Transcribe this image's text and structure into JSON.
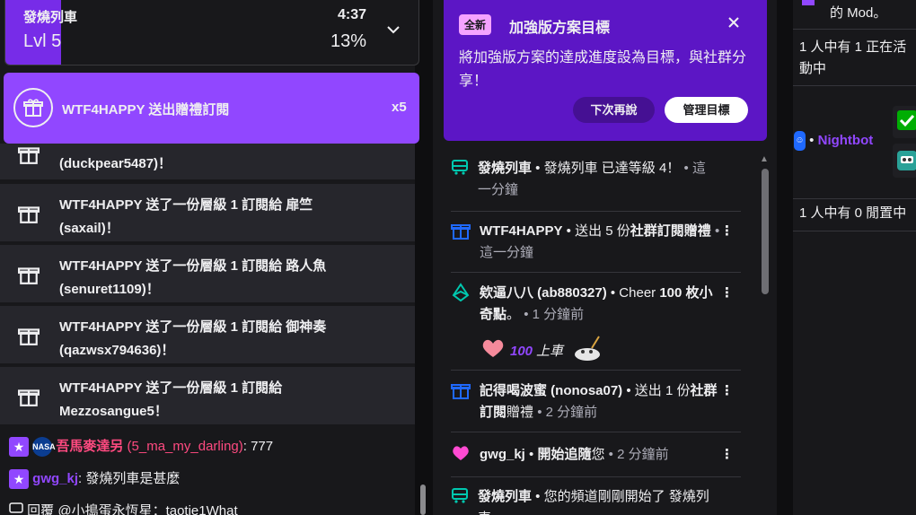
{
  "hype_train": {
    "name": "發燒列車",
    "level": "Lvl 5",
    "time": "4:37",
    "percent": "13%",
    "progress": 0.13
  },
  "ghost_text": "… … … … 的 的 … … …",
  "gift_banner": {
    "text": "WTF4HAPPY 送出贈禮訂閱",
    "count": "x5"
  },
  "gift_notices": [
    {
      "pre": "",
      "target": "",
      "line2": "(duckpear5487)！"
    },
    {
      "pre": "WTF4HAPPY 送了一份層級 1 訂閱給 ",
      "target": "扉竺",
      "line2": "(saxail)！"
    },
    {
      "pre": "WTF4HAPPY 送了一份層級 1 訂閱給 ",
      "target": "路人魚",
      "line2": "(senuret1109)！"
    },
    {
      "pre": "WTF4HAPPY 送了一份層級 1 訂閱給 ",
      "target": "御神奏",
      "line2": "(qazwsx794636)！"
    },
    {
      "pre": "WTF4HAPPY 送了一份層級 1 訂閱給",
      "target": "",
      "line2": "Mezzosangue5！"
    }
  ],
  "chat": [
    {
      "user": "吾馬麥達另",
      "login": " (5_ma_my_darling)",
      "msg": ": 777",
      "color": "#ff4a80"
    },
    {
      "user": "gwg_kj",
      "login": "",
      "msg": ": 發燒列車是甚麼",
      "color": "#9147ff"
    }
  ],
  "reply_line": "回覆 @小搗蛋永恆星：taotie1What",
  "goal": {
    "badge": "全新",
    "title": "加強版方案目標",
    "desc": "將加強版方案的達成進度設為目標，與社群分享！",
    "later": "下次再說",
    "manage": "管理目標"
  },
  "activity": [
    {
      "icon": "train",
      "name": "發燒列車",
      "text": " • 發燒列車 已達等級 4！",
      "time": " • 這一分鐘"
    },
    {
      "icon": "gift",
      "name": "WTF4HAPPY",
      "text": " • 送出 5 份",
      "bold": "社群訂閱",
      "text2": "贈禮",
      "time": " • 這一分鐘"
    },
    {
      "icon": "bits",
      "name": "欸逼八八 (ab880327)",
      "text": " • Cheer ",
      "bold": "100 枚小奇點",
      "text2": "。",
      "time": " • 1 分鐘前",
      "cheer_amount": "100",
      "cheer_msg": "上車"
    },
    {
      "icon": "gift",
      "name": "記得喝波蜜 (nonosa07)",
      "text": " • 送出 1 份",
      "bold": "社群訂閱",
      "text2": "贈禮",
      "time": " • 2 分鐘前"
    },
    {
      "icon": "heart",
      "name": "gwg_kj",
      "text": " • ",
      "bold": "開始追隨",
      "text2": "您",
      "time": " • 2 分鐘前"
    },
    {
      "icon": "train",
      "name": "發燒列車",
      "text": " • 您的頻道剛剛開始了 發燒列車",
      "time": ""
    }
  ],
  "right_panel": {
    "mod_tail": "的 Mod。",
    "active_line1": "1 人中有 1 正在活",
    "active_line2": "動中",
    "bot_name": "Nightbot",
    "idle_line": "1 人中有 0 閒置中"
  },
  "colors": {
    "purple": "#9147ff",
    "dark_purple": "#5c16c5",
    "pink": "#ff4a80",
    "teal": "#00c8af",
    "blue": "#1f69ff"
  }
}
